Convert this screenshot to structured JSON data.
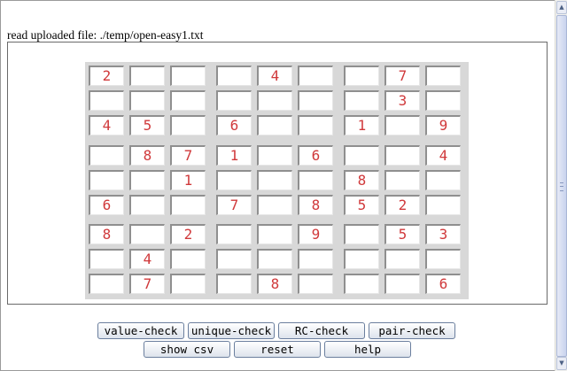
{
  "status": {
    "text": "read uploaded file: ./temp/open-easy1.txt"
  },
  "grid": {
    "rows": [
      [
        "2",
        "",
        "",
        "",
        "4",
        "",
        "",
        "7",
        ""
      ],
      [
        "",
        "",
        "",
        "",
        "",
        "",
        "",
        "3",
        ""
      ],
      [
        "4",
        "5",
        "",
        "6",
        "",
        "",
        "1",
        "",
        "9"
      ],
      [
        "",
        "8",
        "7",
        "1",
        "",
        "6",
        "",
        "",
        "4"
      ],
      [
        "",
        "",
        "1",
        "",
        "",
        "",
        "8",
        "",
        ""
      ],
      [
        "6",
        "",
        "",
        "7",
        "",
        "8",
        "5",
        "2",
        ""
      ],
      [
        "8",
        "",
        "2",
        "",
        "",
        "9",
        "",
        "5",
        "3"
      ],
      [
        "",
        "4",
        "",
        "",
        "",
        "",
        "",
        "",
        ""
      ],
      [
        "",
        "7",
        "",
        "",
        "8",
        "",
        "",
        "",
        "6"
      ]
    ],
    "colors": {
      "given_digit": "#d0393b"
    }
  },
  "buttons": {
    "row1": [
      {
        "id": "value-check",
        "label": "value-check"
      },
      {
        "id": "unique-check",
        "label": "unique-check"
      },
      {
        "id": "rc-check",
        "label": "RC-check"
      },
      {
        "id": "pair-check",
        "label": "pair-check"
      }
    ],
    "row2": [
      {
        "id": "show-csv",
        "label": "show csv"
      },
      {
        "id": "reset",
        "label": "reset"
      },
      {
        "id": "help",
        "label": "help"
      }
    ]
  },
  "scrollbar": {
    "up_icon": "triangle-up-icon",
    "down_icon": "triangle-down-icon"
  }
}
